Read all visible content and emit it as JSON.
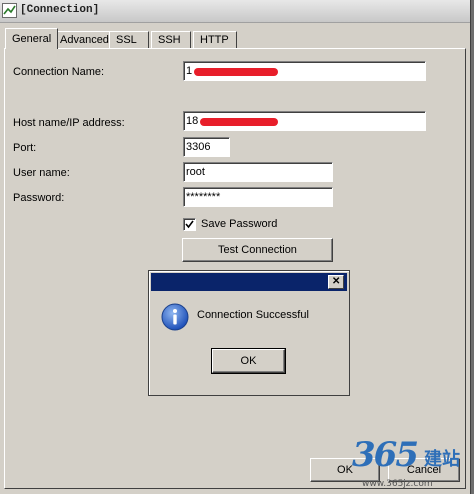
{
  "window": {
    "title": "[Connection]"
  },
  "tabs": [
    {
      "label": "General",
      "active": true
    },
    {
      "label": "Advanced"
    },
    {
      "label": "SSL"
    },
    {
      "label": "SSH"
    },
    {
      "label": "HTTP"
    }
  ],
  "form": {
    "connection_name_label": "Connection Name:",
    "connection_name_value": "1",
    "host_label": "Host name/IP address:",
    "host_value": "18",
    "port_label": "Port:",
    "port_value": "3306",
    "user_label": "User name:",
    "user_value": "root",
    "password_label": "Password:",
    "password_value": "********",
    "save_password_label": "Save Password",
    "save_password_checked": true,
    "test_button": "Test Connection",
    "redaction_color": "#e81e2a"
  },
  "dialog": {
    "message": "Connection Successful",
    "ok_label": "OK",
    "close_glyph": "✕",
    "info_icon": "info-icon"
  },
  "bottom_buttons": {
    "ok_label": "OK",
    "cancel_label": "Cancel"
  },
  "watermark": {
    "number": "365",
    "chinese": "建站",
    "url": "www.365jz.com"
  }
}
